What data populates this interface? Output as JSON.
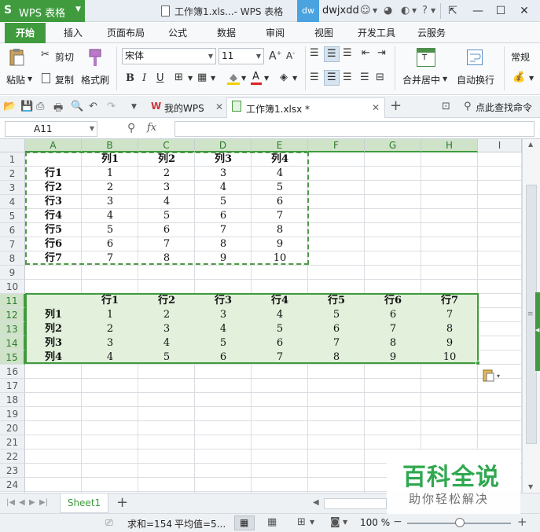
{
  "titlebar": {
    "app_name": "WPS 表格",
    "window_title": "工作簿1.xls...- WPS 表格",
    "avatar_text": "dw",
    "username": "dwjxdd"
  },
  "menu": {
    "tabs": [
      "开始",
      "插入",
      "页面布局",
      "公式",
      "数据",
      "审阅",
      "视图",
      "开发工具",
      "云服务"
    ]
  },
  "ribbon": {
    "cut": "剪切",
    "paste": "粘贴",
    "copy": "复制",
    "format_painter": "格式刷",
    "font_name": "宋体",
    "font_size": "11",
    "merge_center": "合并居中",
    "wrap_text": "自动换行",
    "number_format": "常规"
  },
  "doc_tabs": {
    "my_wps": "我的WPS",
    "workbook": "工作簿1.xlsx *",
    "search": "点此查找命令"
  },
  "formula": {
    "name_box": "A11",
    "fx": "fx",
    "content": ""
  },
  "grid": {
    "columns": [
      "A",
      "B",
      "C",
      "D",
      "E",
      "F",
      "G",
      "H",
      "I"
    ],
    "rows": [
      "1",
      "2",
      "3",
      "4",
      "5",
      "6",
      "7",
      "8",
      "9",
      "10",
      "11",
      "12",
      "13",
      "14",
      "15",
      "16",
      "17",
      "18",
      "19",
      "20",
      "21",
      "22",
      "23",
      "24"
    ],
    "table1_header": [
      "列1",
      "列2",
      "列3",
      "列4"
    ],
    "table1_rows": [
      {
        "label": "行1",
        "values": [
          "1",
          "2",
          "3",
          "4"
        ]
      },
      {
        "label": "行2",
        "values": [
          "2",
          "3",
          "4",
          "5"
        ]
      },
      {
        "label": "行3",
        "values": [
          "3",
          "4",
          "5",
          "6"
        ]
      },
      {
        "label": "行4",
        "values": [
          "4",
          "5",
          "6",
          "7"
        ]
      },
      {
        "label": "行5",
        "values": [
          "5",
          "6",
          "7",
          "8"
        ]
      },
      {
        "label": "行6",
        "values": [
          "6",
          "7",
          "8",
          "9"
        ]
      },
      {
        "label": "行7",
        "values": [
          "7",
          "8",
          "9",
          "10"
        ]
      }
    ],
    "table2_header": [
      "行1",
      "行2",
      "行3",
      "行4",
      "行5",
      "行6",
      "行7"
    ],
    "table2_rows": [
      {
        "label": "列1",
        "values": [
          "1",
          "2",
          "3",
          "4",
          "5",
          "6",
          "7"
        ]
      },
      {
        "label": "列2",
        "values": [
          "2",
          "3",
          "4",
          "5",
          "6",
          "7",
          "8"
        ]
      },
      {
        "label": "列3",
        "values": [
          "3",
          "4",
          "5",
          "6",
          "7",
          "8",
          "9"
        ]
      },
      {
        "label": "列4",
        "values": [
          "4",
          "5",
          "6",
          "7",
          "8",
          "9",
          "10"
        ]
      }
    ]
  },
  "sheets": {
    "active": "Sheet1",
    "add": "+"
  },
  "status": {
    "sum": "求和=154",
    "average": "平均值=5...",
    "zoom": "100 %"
  },
  "watermark": {
    "title": "百科全说",
    "subtitle": "助你轻松解决"
  },
  "colors": {
    "accent": "#3f9b3d",
    "selection_fill": "#e3f1dc",
    "dashed_border": "#4e9a47"
  }
}
